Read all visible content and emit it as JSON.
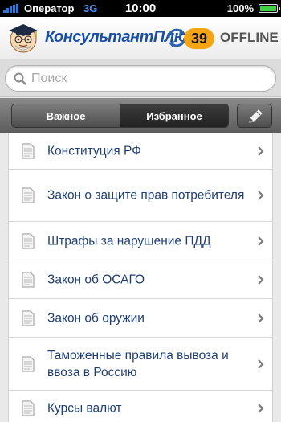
{
  "status": {
    "carrier": "Оператор",
    "network": "3G",
    "time": "10:00",
    "battery": "100%",
    "battery_level": 1.0
  },
  "header": {
    "brand": "КонсультантПлюс",
    "badge_count": "39",
    "offline_label": "OFFLINE"
  },
  "search": {
    "placeholder": "Поиск"
  },
  "tabs": {
    "important": "Важное",
    "favorites": "Избранное",
    "active": "favorites"
  },
  "list": {
    "items": [
      {
        "label": "Конституция РФ"
      },
      {
        "label": "Закон о защите прав потребителя"
      },
      {
        "label": "Штрафы за нарушение ПДД"
      },
      {
        "label": "Закон об ОСАГО"
      },
      {
        "label": "Закон об оружии"
      },
      {
        "label": "Таможенные правила вывоза и ввоза в Россию"
      },
      {
        "label": "Курсы валют"
      }
    ]
  },
  "colors": {
    "brand_blue": "#1a4ea3",
    "badge_orange": "#f5a414",
    "item_text": "#1f3f74"
  }
}
